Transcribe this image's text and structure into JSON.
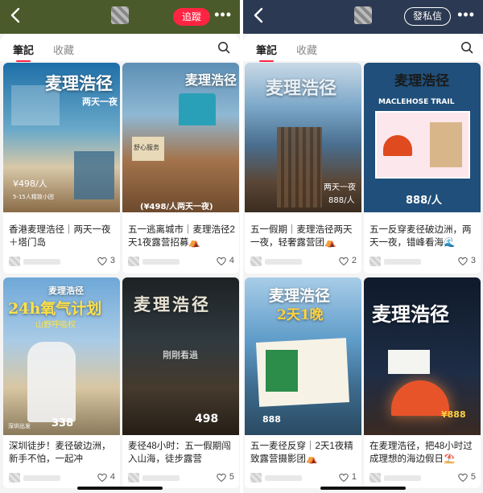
{
  "left": {
    "header": {
      "follow_label": "追蹤"
    },
    "tabs": [
      "筆記",
      "收藏"
    ],
    "cards": [
      {
        "caption": "香港麦理浩径｜两天一夜＋塔门岛",
        "likes": "3",
        "poster_title": "麦理浩径",
        "poster_sub": "两天一夜",
        "price": "¥498/人",
        "note": "5-15人精致小团"
      },
      {
        "caption": "五一逃离城市｜麦理浩径2天1夜露营招募⛺",
        "likes": "4",
        "poster_title": "麦理浩径",
        "price": "(¥498/人两天一夜)",
        "note": "舒心服务"
      },
      {
        "caption": "深圳徒步！麦径破边洲，新手不怕，一起冲",
        "likes": "4",
        "poster_title": "麦理浩径",
        "poster_big": "24h氧气计划",
        "poster_sub": "山野呼吸权",
        "price": "338",
        "note": "深圳出发"
      },
      {
        "caption": "麦径48小时：五一假期闯入山海，徒步露营",
        "likes": "5",
        "poster_title": "麦理浩径",
        "price": "498",
        "overlay": "剛剛看過"
      }
    ]
  },
  "right": {
    "header": {
      "message_label": "發私信"
    },
    "tabs": [
      "筆記",
      "收藏"
    ],
    "cards": [
      {
        "caption": "五一假期｜麦理浩径两天一夜，轻奢露营团⛺",
        "likes": "2",
        "poster_title": "麦理浩径",
        "poster_sub": "两天一夜",
        "price": "888/人"
      },
      {
        "caption": "五一反穿麦径破边洲，两天一夜，错峰看海🌊",
        "likes": "3",
        "poster_title": "麦理浩径",
        "poster_sub": "MACLEHOSE TRAIL",
        "price": "888/人"
      },
      {
        "caption": "五一麦径反穿｜2天1夜精致露营摄影团⛺",
        "likes": "1",
        "poster_title": "麦理浩径",
        "poster_big": "2天1晚",
        "price": "888"
      },
      {
        "caption": "在麦理浩径，把48小时过成理想的海边假日⛱️",
        "likes": "5",
        "poster_title": "麦理浩径",
        "price": "¥888"
      }
    ]
  },
  "colors": {
    "accent": "#ff2442"
  }
}
